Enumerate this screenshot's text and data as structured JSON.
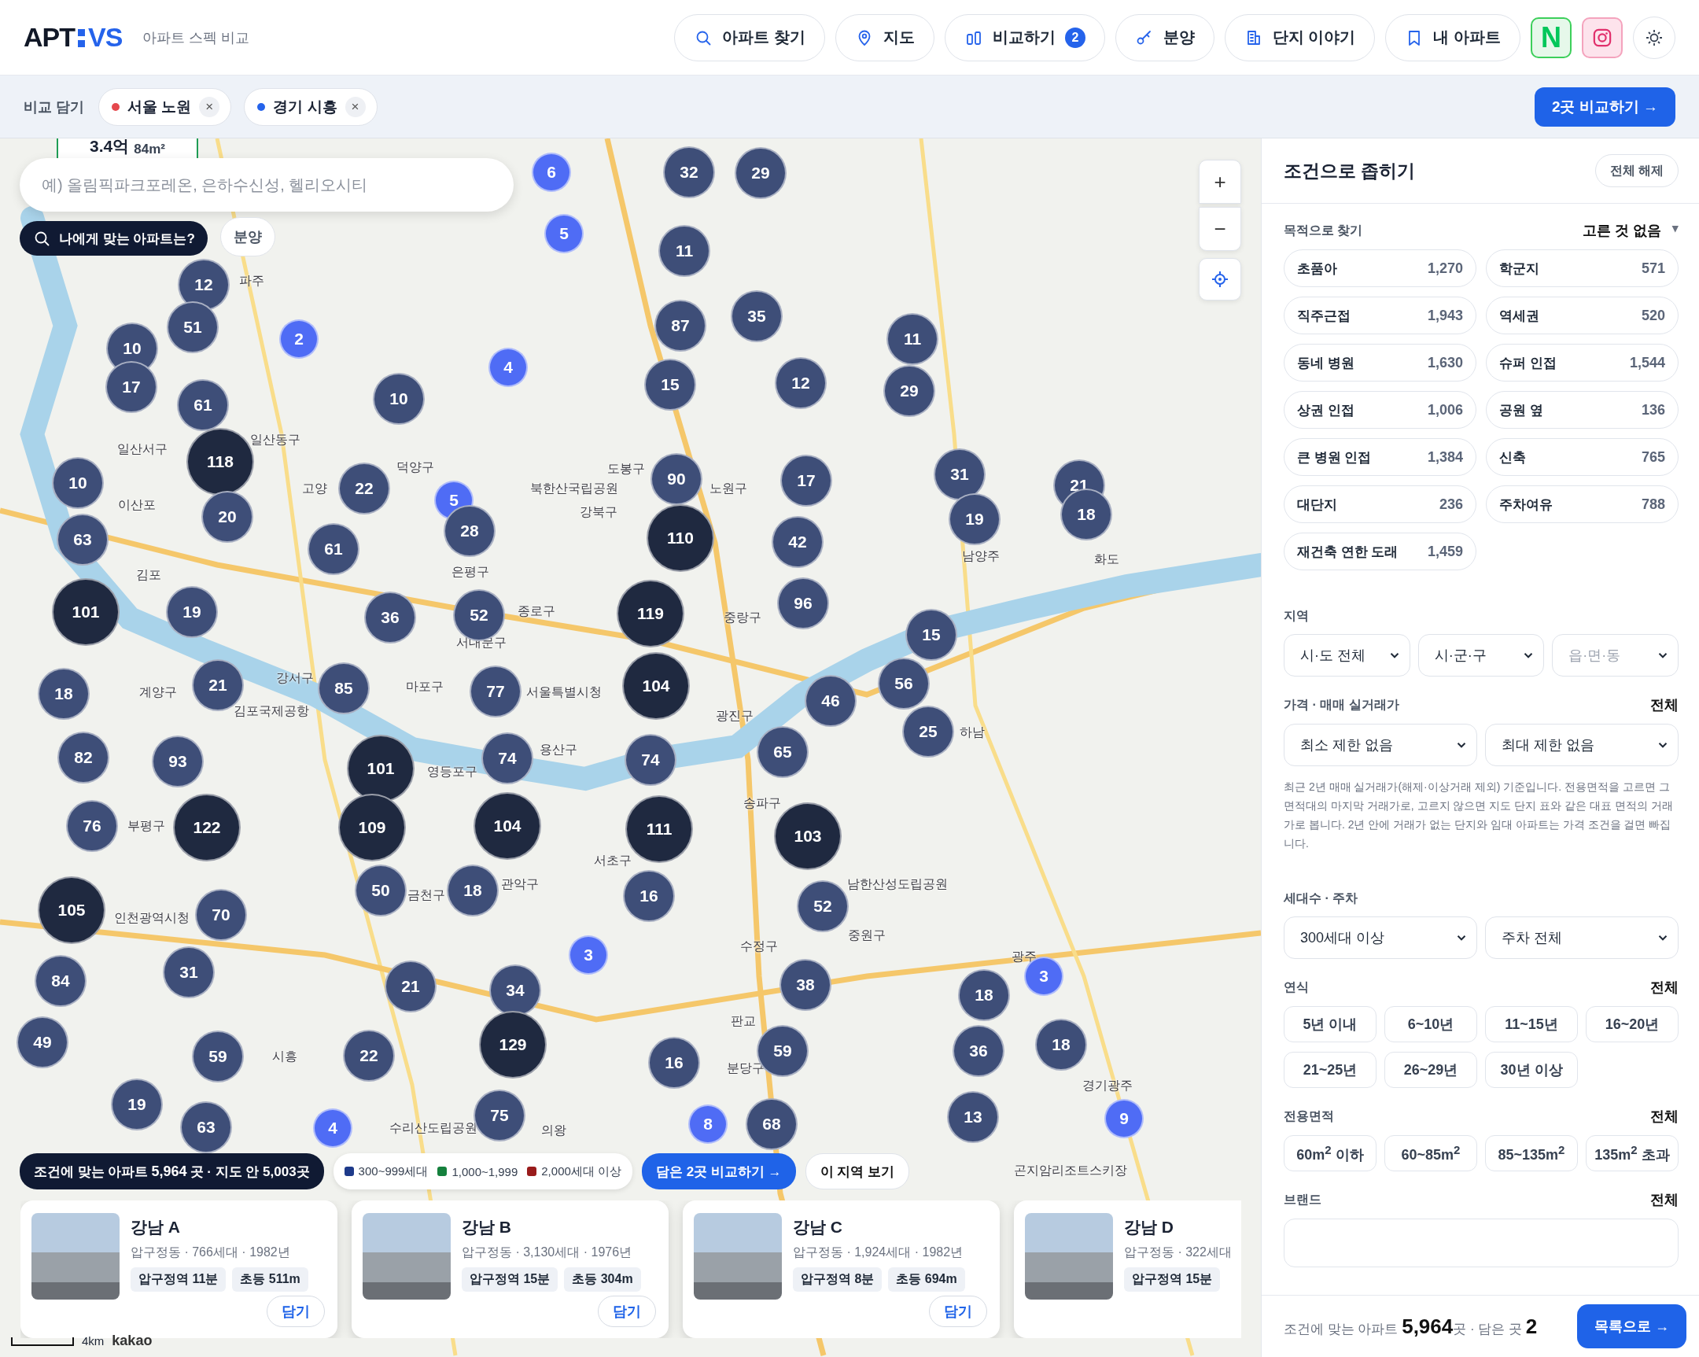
{
  "header": {
    "logo": {
      "left": "APT",
      "right": "VS"
    },
    "tagline": "아파트 스펙 비교",
    "nav": [
      {
        "label": "아파트 찾기"
      },
      {
        "label": "지도"
      },
      {
        "label": "비교하기",
        "badge": "2"
      },
      {
        "label": "분양"
      },
      {
        "label": "단지 이야기"
      },
      {
        "label": "내 아파트"
      }
    ],
    "naver": "N"
  },
  "compare_bar": {
    "label": "비교 담기",
    "chips": [
      {
        "name": "서울 노원",
        "color": "#e5484d",
        "remove": "×"
      },
      {
        "name": "경기 시흥",
        "color": "#2563eb",
        "remove": "×"
      }
    ],
    "button": "2곳 비교하기 →"
  },
  "map": {
    "price_tag": {
      "price": "3.4억",
      "area": "84m²"
    },
    "search": {
      "placeholder": "예) 올림픽파크포레온, 은하수신성, 헬리오시티"
    },
    "quiz_button": "나에게 맞는 아파트는?",
    "sale_button": "분양",
    "zoom_in": "+",
    "zoom_out": "−",
    "places": [
      "파주",
      "일산서구",
      "일산동구",
      "덕양구",
      "도봉구",
      "고양",
      "북한산국립공원",
      "노원구",
      "이산포",
      "강북구",
      "남양주",
      "화도",
      "김포",
      "은평구",
      "종로구",
      "중랑구",
      "서대문구",
      "계양구",
      "강서구",
      "마포구",
      "서울특별시청",
      "김포국제공항",
      "광진구",
      "하남",
      "용산구",
      "영등포구",
      "송파구",
      "부평구",
      "서초구",
      "금천구",
      "관악구",
      "남한산성도립공원",
      "인천광역시청",
      "수정구",
      "중원구",
      "광주",
      "판교",
      "시흥",
      "분당구",
      "경기광주",
      "수리산도립공원",
      "의왕",
      "곤지암리조트스키장"
    ],
    "clusters": [
      {
        "count": "6",
        "kind": "few"
      },
      {
        "count": "32",
        "kind": "normal"
      },
      {
        "count": "29",
        "kind": "normal"
      },
      {
        "count": "5",
        "kind": "few"
      },
      {
        "count": "11",
        "kind": "normal"
      },
      {
        "count": "12",
        "kind": "normal"
      },
      {
        "count": "10",
        "kind": "normal"
      },
      {
        "count": "51",
        "kind": "normal"
      },
      {
        "count": "2",
        "kind": "few"
      },
      {
        "count": "87",
        "kind": "normal"
      },
      {
        "count": "35",
        "kind": "normal"
      },
      {
        "count": "11",
        "kind": "normal"
      },
      {
        "count": "17",
        "kind": "normal"
      },
      {
        "count": "61",
        "kind": "normal"
      },
      {
        "count": "10",
        "kind": "normal"
      },
      {
        "count": "4",
        "kind": "few"
      },
      {
        "count": "15",
        "kind": "normal"
      },
      {
        "count": "12",
        "kind": "normal"
      },
      {
        "count": "29",
        "kind": "normal"
      },
      {
        "count": "10",
        "kind": "normal"
      },
      {
        "count": "118",
        "kind": "dense"
      },
      {
        "count": "22",
        "kind": "normal"
      },
      {
        "count": "90",
        "kind": "normal"
      },
      {
        "count": "17",
        "kind": "normal"
      },
      {
        "count": "31",
        "kind": "normal"
      },
      {
        "count": "21",
        "kind": "normal"
      },
      {
        "count": "20",
        "kind": "normal"
      },
      {
        "count": "5",
        "kind": "few"
      },
      {
        "count": "19",
        "kind": "normal"
      },
      {
        "count": "18",
        "kind": "normal"
      },
      {
        "count": "63",
        "kind": "normal"
      },
      {
        "count": "61",
        "kind": "normal"
      },
      {
        "count": "28",
        "kind": "normal"
      },
      {
        "count": "110",
        "kind": "dense"
      },
      {
        "count": "42",
        "kind": "normal"
      },
      {
        "count": "101",
        "kind": "dense"
      },
      {
        "count": "19",
        "kind": "normal"
      },
      {
        "count": "36",
        "kind": "normal"
      },
      {
        "count": "52",
        "kind": "normal"
      },
      {
        "count": "119",
        "kind": "dense"
      },
      {
        "count": "96",
        "kind": "normal"
      },
      {
        "count": "15",
        "kind": "normal"
      },
      {
        "count": "18",
        "kind": "normal"
      },
      {
        "count": "21",
        "kind": "normal"
      },
      {
        "count": "85",
        "kind": "normal"
      },
      {
        "count": "77",
        "kind": "normal"
      },
      {
        "count": "104",
        "kind": "dense"
      },
      {
        "count": "46",
        "kind": "normal"
      },
      {
        "count": "56",
        "kind": "normal"
      },
      {
        "count": "25",
        "kind": "normal"
      },
      {
        "count": "82",
        "kind": "normal"
      },
      {
        "count": "93",
        "kind": "normal"
      },
      {
        "count": "101",
        "kind": "dense"
      },
      {
        "count": "74",
        "kind": "normal"
      },
      {
        "count": "74",
        "kind": "normal"
      },
      {
        "count": "65",
        "kind": "normal"
      },
      {
        "count": "76",
        "kind": "normal"
      },
      {
        "count": "122",
        "kind": "dense"
      },
      {
        "count": "109",
        "kind": "dense"
      },
      {
        "count": "104",
        "kind": "dense"
      },
      {
        "count": "111",
        "kind": "dense"
      },
      {
        "count": "103",
        "kind": "dense"
      },
      {
        "count": "105",
        "kind": "dense"
      },
      {
        "count": "70",
        "kind": "normal"
      },
      {
        "count": "50",
        "kind": "normal"
      },
      {
        "count": "18",
        "kind": "normal"
      },
      {
        "count": "16",
        "kind": "normal"
      },
      {
        "count": "52",
        "kind": "normal"
      },
      {
        "count": "84",
        "kind": "normal"
      },
      {
        "count": "31",
        "kind": "normal"
      },
      {
        "count": "21",
        "kind": "normal"
      },
      {
        "count": "34",
        "kind": "normal"
      },
      {
        "count": "3",
        "kind": "few"
      },
      {
        "count": "38",
        "kind": "normal"
      },
      {
        "count": "18",
        "kind": "normal"
      },
      {
        "count": "3",
        "kind": "few"
      },
      {
        "count": "49",
        "kind": "normal"
      },
      {
        "count": "59",
        "kind": "normal"
      },
      {
        "count": "22",
        "kind": "normal"
      },
      {
        "count": "129",
        "kind": "dense"
      },
      {
        "count": "16",
        "kind": "normal"
      },
      {
        "count": "59",
        "kind": "normal"
      },
      {
        "count": "36",
        "kind": "normal"
      },
      {
        "count": "18",
        "kind": "normal"
      },
      {
        "count": "19",
        "kind": "normal"
      },
      {
        "count": "63",
        "kind": "normal"
      },
      {
        "count": "4",
        "kind": "few"
      },
      {
        "count": "75",
        "kind": "normal"
      },
      {
        "count": "8",
        "kind": "few"
      },
      {
        "count": "68",
        "kind": "normal"
      },
      {
        "count": "13",
        "kind": "normal"
      },
      {
        "count": "9",
        "kind": "few"
      }
    ],
    "summary": "조건에 맞는 아파트 **5,964** 곳 · 지도 안 5,003곳",
    "legend": [
      {
        "label": "300~999세대",
        "color": "#1e3a8a"
      },
      {
        "label": "1,000~1,999",
        "color": "#15803d"
      },
      {
        "label": "2,000세대 이상",
        "color": "#991b1b"
      }
    ],
    "compare_button": "담은 2곳 비교하기 →",
    "area_button": "이 지역 보기",
    "cards": [
      {
        "name": "강남 A",
        "meta": "압구정동 · 766세대 · 1982년",
        "tags": [
          "압구정역 11분",
          "초등 511m"
        ],
        "add": "담기"
      },
      {
        "name": "강남 B",
        "meta": "압구정동 · 3,130세대 · 1976년",
        "tags": [
          "압구정역 15분",
          "초등 304m"
        ],
        "add": "담기"
      },
      {
        "name": "강남 C",
        "meta": "압구정동 · 1,924세대 · 1982년",
        "tags": [
          "압구정역 8분",
          "초등 694m"
        ],
        "add": "담기"
      },
      {
        "name": "강남 D",
        "meta": "압구정동 · 322세대",
        "tags": [
          "압구정역 15분"
        ]
      }
    ],
    "scale": "4km",
    "attribution": "kakao"
  },
  "panel": {
    "title": "조건으로 좁히기",
    "reset": "전체 해제",
    "purpose": {
      "label": "목적으로 찾기",
      "value": "고른 것 없음",
      "caret": "▾",
      "chips": [
        {
          "label": "초품아",
          "count": "1,270"
        },
        {
          "label": "학군지",
          "count": "571"
        },
        {
          "label": "직주근접",
          "count": "1,943"
        },
        {
          "label": "역세권",
          "count": "520"
        },
        {
          "label": "동네 병원",
          "count": "1,630"
        },
        {
          "label": "슈퍼 인접",
          "count": "1,544"
        },
        {
          "label": "상권 인접",
          "count": "1,006"
        },
        {
          "label": "공원 옆",
          "count": "136"
        },
        {
          "label": "큰 병원 인접",
          "count": "1,384"
        },
        {
          "label": "신축",
          "count": "765"
        },
        {
          "label": "대단지",
          "count": "236"
        },
        {
          "label": "주차여유",
          "count": "788"
        },
        {
          "label": "재건축 연한 도래",
          "count": "1,459"
        }
      ]
    },
    "region": {
      "label": "지역",
      "selects": [
        {
          "value": "시·도 전체",
          "disabled": false
        },
        {
          "value": "시·군·구",
          "disabled": false
        },
        {
          "value": "읍·면·동",
          "disabled": true
        }
      ]
    },
    "price": {
      "label": "가격 · 매매 실거래가",
      "value": "전체",
      "selects": [
        {
          "value": "최소 제한 없음",
          "disabled": false
        },
        {
          "value": "최대 제한 없음",
          "disabled": false
        }
      ],
      "note": "최근 2년 매매 실거래가(해제·이상거래 제외) 기준입니다. 전용면적을 고르면 그 면적대의 마지막 거래가로, 고르지 않으면 지도 단지 표와 같은 대표 면적의 거래가로 봅니다. 2년 안에 거래가 없는 단지와 임대 아파트는 가격 조건을 걸면 빠집니다."
    },
    "households": {
      "label": "세대수 · 주차",
      "selects": [
        {
          "value": "300세대 이상",
          "disabled": false
        },
        {
          "value": "주차 전체",
          "disabled": false
        }
      ]
    },
    "age": {
      "label": "연식",
      "value": "전체",
      "options": [
        "5년 이내",
        "6~10년",
        "11~15년",
        "16~20년",
        "21~25년",
        "26~29년",
        "30년 이상"
      ]
    },
    "size": {
      "label": "전용면적",
      "value": "전체",
      "options": [
        "60m$^{2}$ 이하",
        "60~85m$^{2}$",
        "85~135m$^{2}$",
        "135m$^{2}$ 초과"
      ]
    },
    "brand": {
      "label": "브랜드",
      "value": "전체"
    },
    "footer": {
      "text": "조건에 맞는 아파트 **5,964**곳 · 담은 곳 **2**",
      "button": "목록으로 →"
    }
  }
}
